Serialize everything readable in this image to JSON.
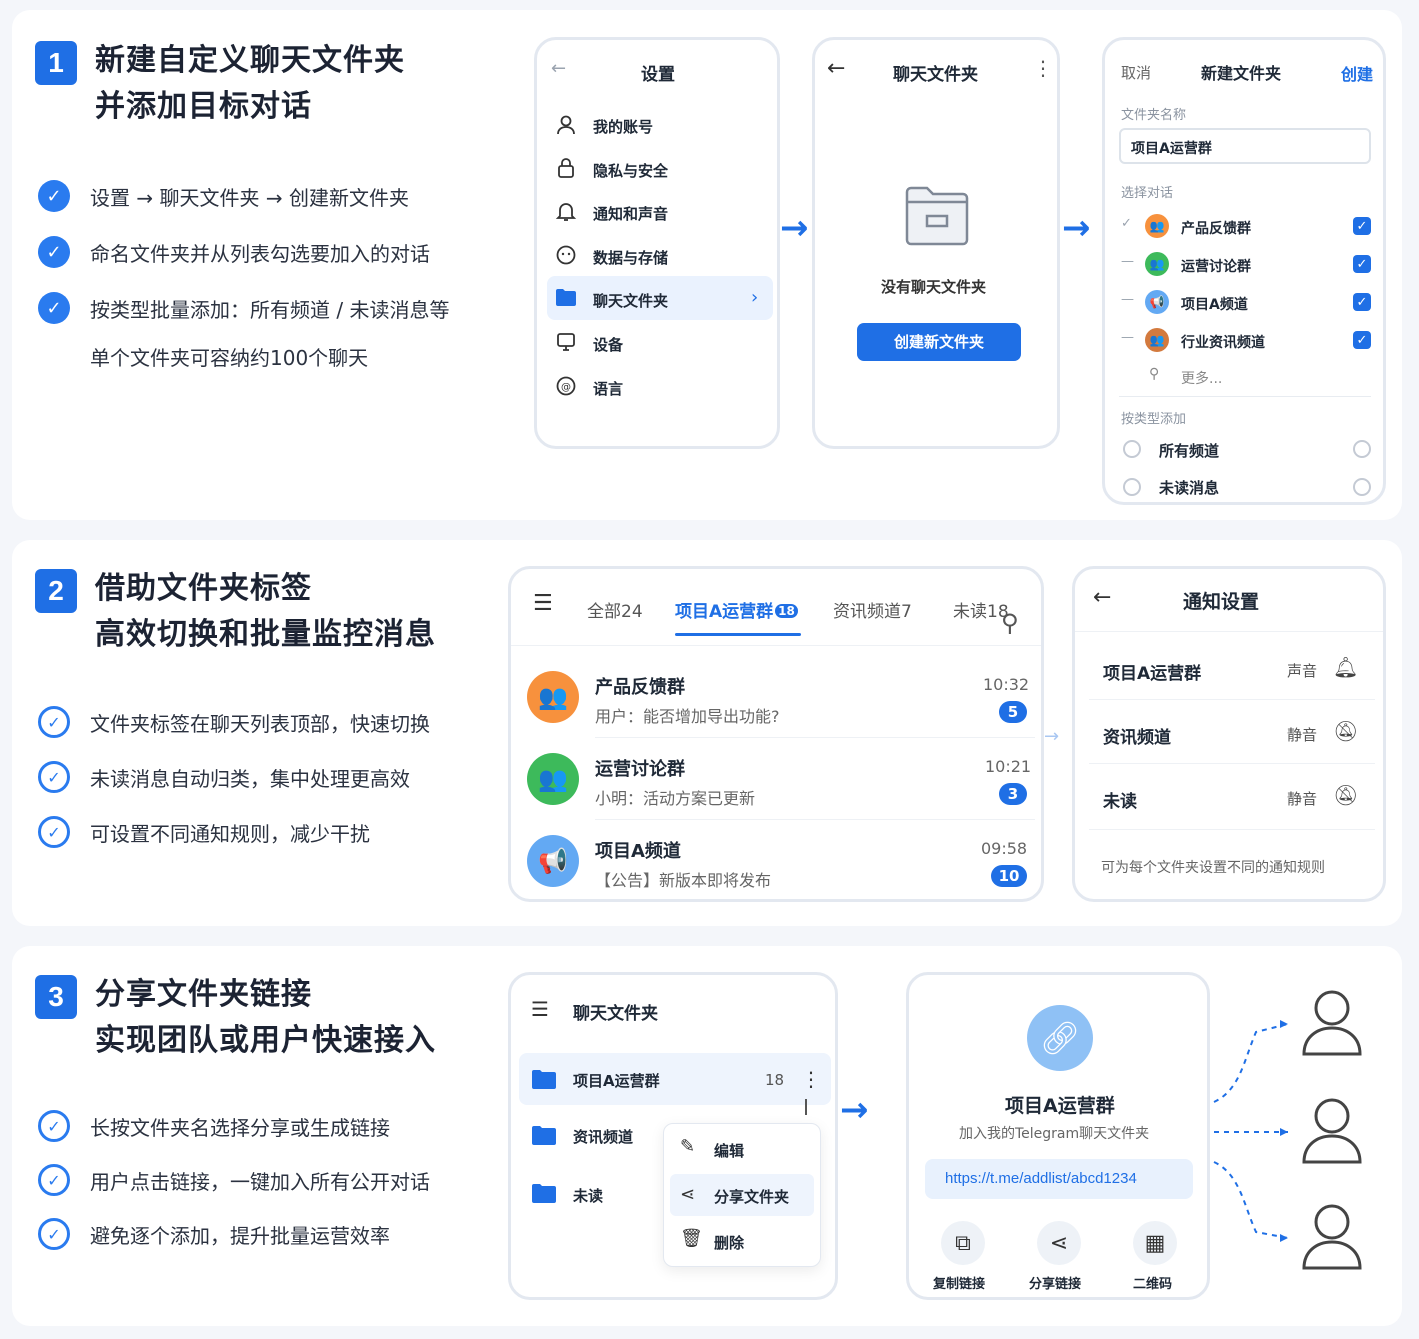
{
  "s1": {
    "num": "1",
    "title1": "新建自定义聊天文件夹",
    "title2": "并添加目标对话",
    "bullets": [
      "设置 → 聊天文件夹 → 创建新文件夹",
      "命名文件夹并从列表勾选要加入的对话",
      "按类型批量添加：所有频道 / 未读消息等",
      "单个文件夹可容纳约100个聊天"
    ],
    "settings": {
      "title": "设置",
      "items": [
        "我的账号",
        "隐私与安全",
        "通知和声音",
        "数据与存储",
        "聊天文件夹",
        "设备",
        "语言"
      ]
    },
    "folders": {
      "title": "聊天文件夹",
      "empty": "没有聊天文件夹",
      "create": "创建新文件夹"
    },
    "newfolder": {
      "cancel": "取消",
      "title": "新建文件夹",
      "create": "创建",
      "name_label": "文件夹名称",
      "name_value": "项目A运营群",
      "select_label": "选择对话",
      "chats": [
        "产品反馈群",
        "运营讨论群",
        "项目A频道",
        "行业资讯频道"
      ],
      "more": "更多...",
      "type_label": "按类型添加",
      "types": [
        "所有频道",
        "未读消息"
      ]
    }
  },
  "s2": {
    "num": "2",
    "title1": "借助文件夹标签",
    "title2": "高效切换和批量监控消息",
    "bullets": [
      "文件夹标签在聊天列表顶部，快速切换",
      "未读消息自动归类，集中处理更高效",
      "可设置不同通知规则，减少干扰"
    ],
    "tabs": [
      {
        "label": "全部",
        "count": "24"
      },
      {
        "label": "项目A运营群",
        "count": "18"
      },
      {
        "label": "资讯频道",
        "count": "7"
      },
      {
        "label": "未读",
        "count": "18"
      }
    ],
    "chats": [
      {
        "name": "产品反馈群",
        "msg": "用户：能否增加导出功能?",
        "time": "10:32",
        "count": "5"
      },
      {
        "name": "运营讨论群",
        "msg": "小明：活动方案已更新",
        "time": "10:21",
        "count": "3"
      },
      {
        "name": "项目A频道",
        "msg": "【公告】新版本即将发布",
        "time": "09:58",
        "count": "10"
      }
    ],
    "notify": {
      "title": "通知设置",
      "rows": [
        {
          "name": "项目A运营群",
          "state": "声音"
        },
        {
          "name": "资讯频道",
          "state": "静音"
        },
        {
          "name": "未读",
          "state": "静音"
        }
      ],
      "note": "可为每个文件夹设置不同的通知规则"
    }
  },
  "s3": {
    "num": "3",
    "title1": "分享文件夹链接",
    "title2": "实现团队或用户快速接入",
    "bullets": [
      "长按文件夹名选择分享或生成链接",
      "用户点击链接，一键加入所有公开对话",
      "避免逐个添加，提升批量运营效率"
    ],
    "list": {
      "title": "聊天文件夹",
      "items": [
        {
          "name": "项目A运营群",
          "count": "18"
        },
        {
          "name": "资讯频道"
        },
        {
          "name": "未读"
        }
      ],
      "menu": [
        "编辑",
        "分享文件夹",
        "删除"
      ]
    },
    "share": {
      "name": "项目A运营群",
      "sub": "加入我的Telegram聊天文件夹",
      "link": "https://t.me/addlist/abcd1234",
      "actions": [
        "复制链接",
        "分享链接",
        "二维码"
      ]
    }
  },
  "colors": {
    "accent": "#1f6fe5",
    "orange": "#f7913d",
    "green": "#3dba5b",
    "lightblue": "#63a9f3",
    "brown": "#d37a3e"
  }
}
